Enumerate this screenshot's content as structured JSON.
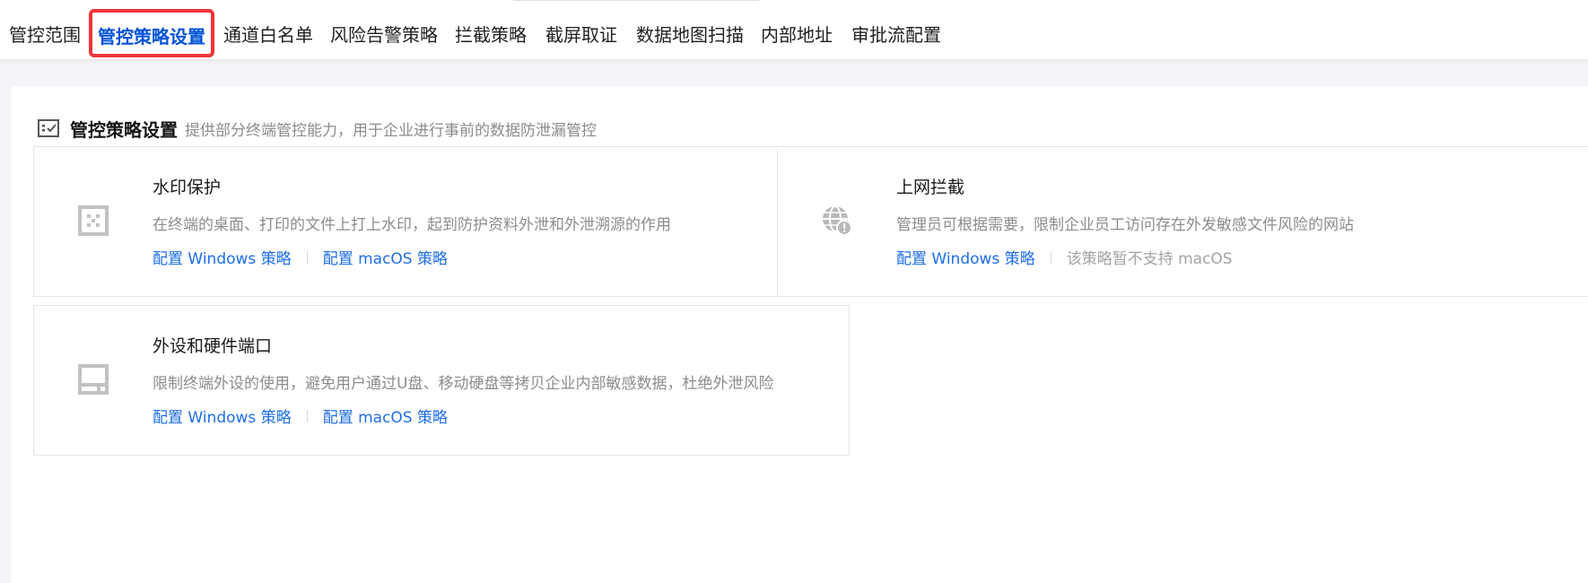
{
  "tabs": [
    {
      "label": "管控范围"
    },
    {
      "label": "管控策略设置"
    },
    {
      "label": "通道白名单"
    },
    {
      "label": "风险告警策略"
    },
    {
      "label": "拦截策略"
    },
    {
      "label": "截屏取证"
    },
    {
      "label": "数据地图扫描"
    },
    {
      "label": "内部地址"
    },
    {
      "label": "审批流配置"
    }
  ],
  "active_tab": "管控策略设置",
  "section": {
    "title": "管控策略设置",
    "description": "提供部分终端管控能力，用于企业进行事前的数据防泄漏管控"
  },
  "cards": [
    {
      "title": "水印保护",
      "description": "在终端的桌面、打印的文件上打上水印，起到防护资料外泄和外泄溯源的作用",
      "icon": "watermark-icon",
      "windows_link": "配置 Windows 策略",
      "macos_link": "配置 macOS 策略"
    },
    {
      "title": "上网拦截",
      "description": "管理员可根据需要，限制企业员工访问存在外发敏感文件风险的网站",
      "icon": "globe-alert-icon",
      "windows_link": "配置 Windows 策略",
      "macos_note": "该策略暂不支持 macOS"
    },
    {
      "title": "外设和硬件端口",
      "description": "限制终端外设的使用，避免用户通过U盘、移动硬盘等拷贝企业内部敏感数据，杜绝外泄风险",
      "icon": "device-port-icon",
      "windows_link": "配置 Windows 策略",
      "macos_link": "配置 macOS 策略"
    }
  ],
  "colors": {
    "accent": "#0052d9",
    "link": "#1e6ee8",
    "highlight_border": "#f0353b",
    "muted_text": "#8c8c8c",
    "page_bg": "#f3f4f7"
  }
}
